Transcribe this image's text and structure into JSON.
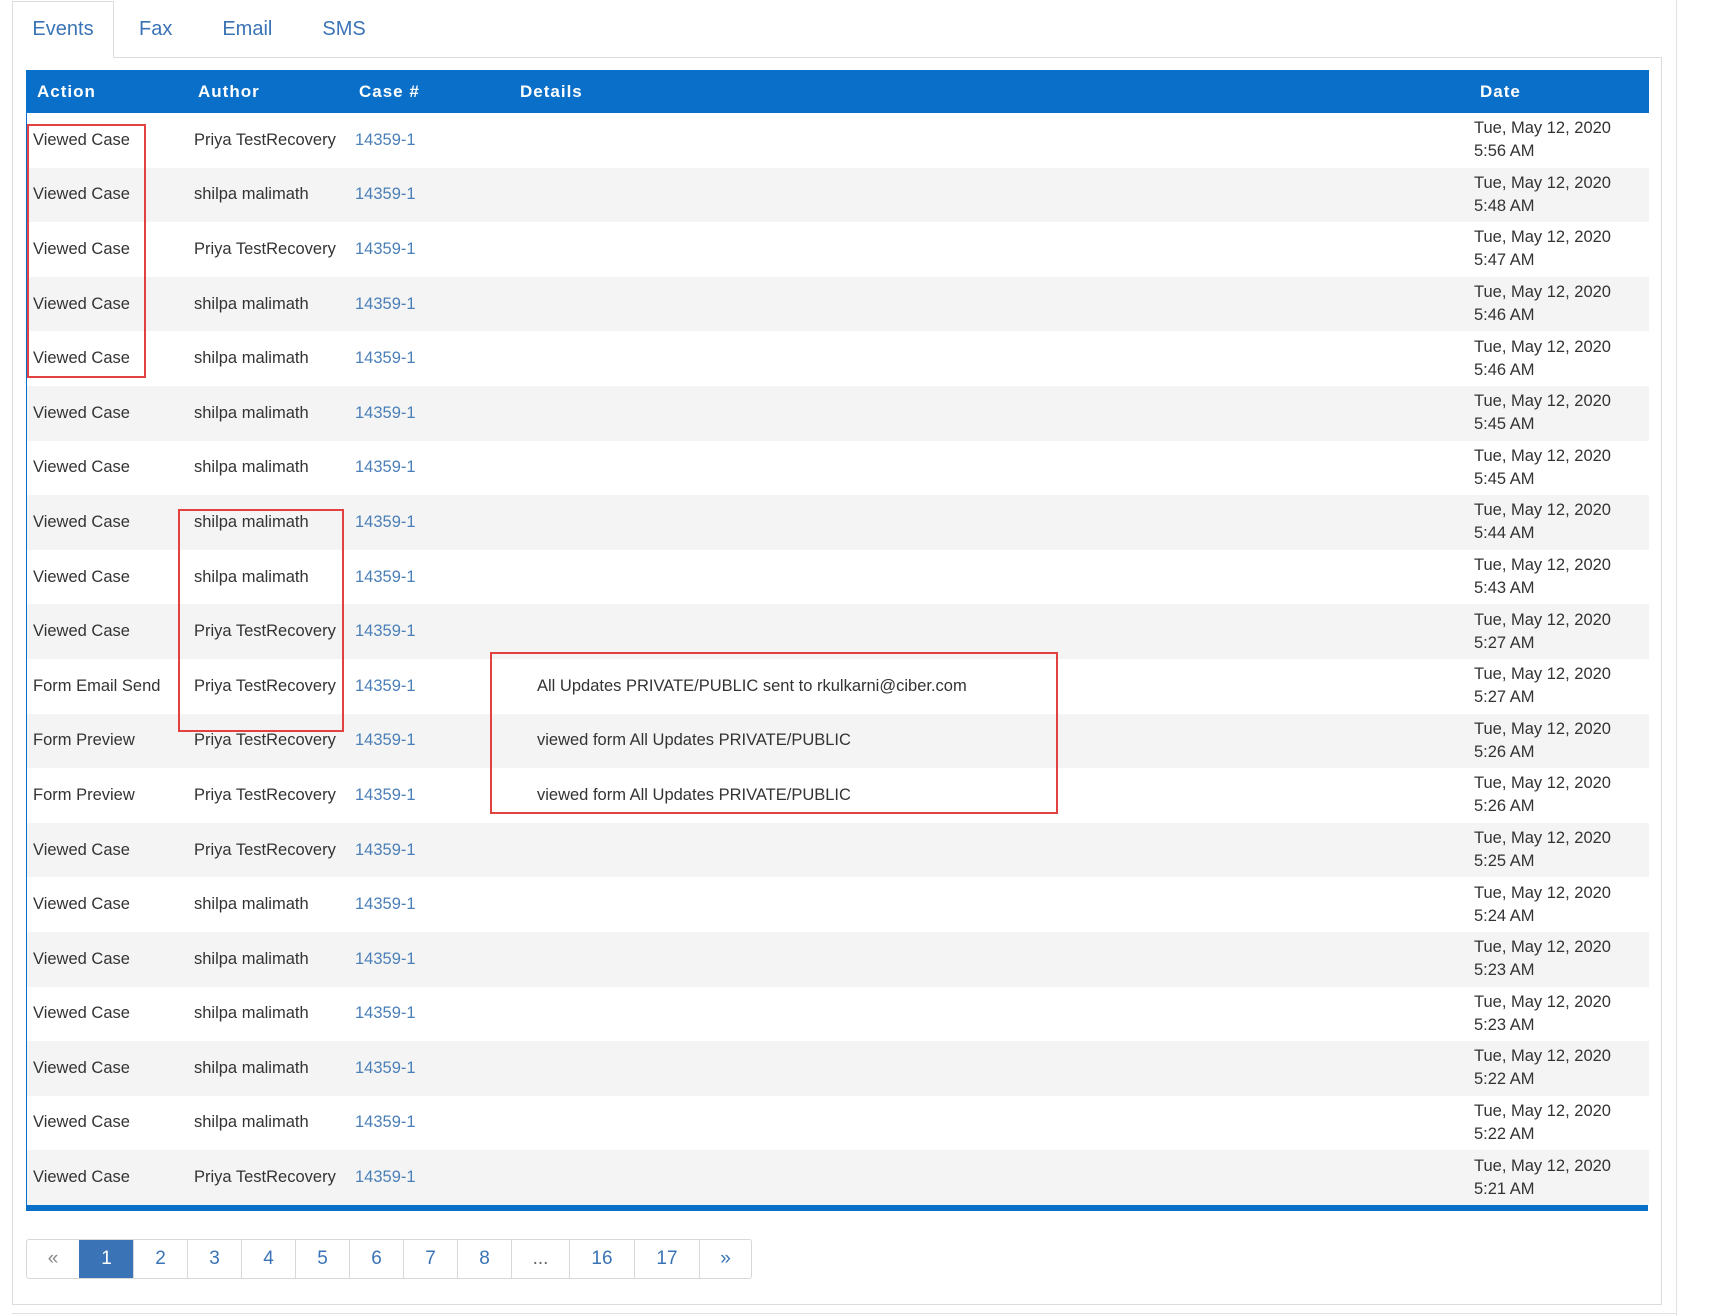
{
  "tabs": [
    "Events",
    "Fax",
    "Email",
    "SMS"
  ],
  "table": {
    "headers": [
      "Action",
      "Author",
      "Case #",
      "Details",
      "Date"
    ],
    "rows": [
      {
        "action": "Viewed Case",
        "author": "Priya TestRecovery",
        "case": "14359-1",
        "details": "",
        "date": "Tue, May 12, 2020",
        "time": "5:56 AM"
      },
      {
        "action": "Viewed Case",
        "author": "shilpa malimath",
        "case": "14359-1",
        "details": "",
        "date": "Tue, May 12, 2020",
        "time": "5:48 AM"
      },
      {
        "action": "Viewed Case",
        "author": "Priya TestRecovery",
        "case": "14359-1",
        "details": "",
        "date": "Tue, May 12, 2020",
        "time": "5:47 AM"
      },
      {
        "action": "Viewed Case",
        "author": "shilpa malimath",
        "case": "14359-1",
        "details": "",
        "date": "Tue, May 12, 2020",
        "time": "5:46 AM"
      },
      {
        "action": "Viewed Case",
        "author": "shilpa malimath",
        "case": "14359-1",
        "details": "",
        "date": "Tue, May 12, 2020",
        "time": "5:46 AM"
      },
      {
        "action": "Viewed Case",
        "author": "shilpa malimath",
        "case": "14359-1",
        "details": "",
        "date": "Tue, May 12, 2020",
        "time": "5:45 AM"
      },
      {
        "action": "Viewed Case",
        "author": "shilpa malimath",
        "case": "14359-1",
        "details": "",
        "date": "Tue, May 12, 2020",
        "time": "5:45 AM"
      },
      {
        "action": "Viewed Case",
        "author": "shilpa malimath",
        "case": "14359-1",
        "details": "",
        "date": "Tue, May 12, 2020",
        "time": "5:44 AM"
      },
      {
        "action": "Viewed Case",
        "author": "shilpa malimath",
        "case": "14359-1",
        "details": "",
        "date": "Tue, May 12, 2020",
        "time": "5:43 AM"
      },
      {
        "action": "Viewed Case",
        "author": "Priya TestRecovery",
        "case": "14359-1",
        "details": "",
        "date": "Tue, May 12, 2020",
        "time": "5:27 AM"
      },
      {
        "action": "Form Email Send",
        "author": "Priya TestRecovery",
        "case": "14359-1",
        "details": "All Updates PRIVATE/PUBLIC sent to rkulkarni@ciber.com",
        "date": "Tue, May 12, 2020",
        "time": "5:27 AM"
      },
      {
        "action": "Form Preview",
        "author": "Priya TestRecovery",
        "case": "14359-1",
        "details": "viewed form All Updates PRIVATE/PUBLIC",
        "date": "Tue, May 12, 2020",
        "time": "5:26 AM"
      },
      {
        "action": "Form Preview",
        "author": "Priya TestRecovery",
        "case": "14359-1",
        "details": "viewed form All Updates PRIVATE/PUBLIC",
        "date": "Tue, May 12, 2020",
        "time": "5:26 AM"
      },
      {
        "action": "Viewed Case",
        "author": "Priya TestRecovery",
        "case": "14359-1",
        "details": "",
        "date": "Tue, May 12, 2020",
        "time": "5:25 AM"
      },
      {
        "action": "Viewed Case",
        "author": "shilpa malimath",
        "case": "14359-1",
        "details": "",
        "date": "Tue, May 12, 2020",
        "time": "5:24 AM"
      },
      {
        "action": "Viewed Case",
        "author": "shilpa malimath",
        "case": "14359-1",
        "details": "",
        "date": "Tue, May 12, 2020",
        "time": "5:23 AM"
      },
      {
        "action": "Viewed Case",
        "author": "shilpa malimath",
        "case": "14359-1",
        "details": "",
        "date": "Tue, May 12, 2020",
        "time": "5:23 AM"
      },
      {
        "action": "Viewed Case",
        "author": "shilpa malimath",
        "case": "14359-1",
        "details": "",
        "date": "Tue, May 12, 2020",
        "time": "5:22 AM"
      },
      {
        "action": "Viewed Case",
        "author": "shilpa malimath",
        "case": "14359-1",
        "details": "",
        "date": "Tue, May 12, 2020",
        "time": "5:22 AM"
      },
      {
        "action": "Viewed Case",
        "author": "Priya TestRecovery",
        "case": "14359-1",
        "details": "",
        "date": "Tue, May 12, 2020",
        "time": "5:21 AM"
      }
    ]
  },
  "pagination": {
    "items": [
      "«",
      "1",
      "2",
      "3",
      "4",
      "5",
      "6",
      "7",
      "8",
      "...",
      "16",
      "17",
      "»"
    ],
    "active": "1"
  },
  "colors": {
    "header_bg": "#0a6fc8",
    "link": "#4a7fb8",
    "highlight_box": "#e34040",
    "row_stripe": "#f4f4f4"
  }
}
